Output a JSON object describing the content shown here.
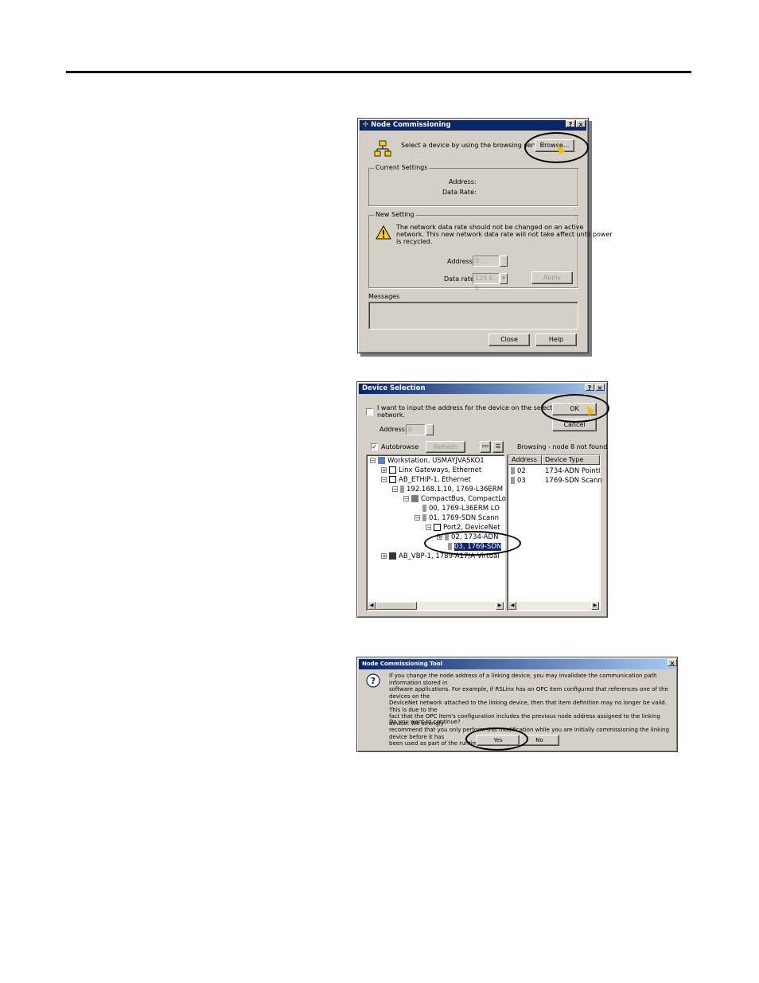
{
  "node_commissioning": {
    "title": "Node Commissioning",
    "help_btn": "?",
    "close_btn": "×",
    "prompt": "Select a device by using the browsing service",
    "browse_label": "Browse...",
    "current_settings": {
      "title": "Current Settings",
      "address_label": "Address:",
      "data_rate_label": "Data Rate:"
    },
    "new_setting": {
      "title": "New Setting",
      "warning_line1": "The network data rate should not be changed on an active",
      "warning_line2": "network. This new network data rate will not take affect until power",
      "warning_line3": "is recycled.",
      "address_label": "Address",
      "address_value": "0",
      "data_rate_label": "Data rate",
      "data_rate_value": "125 k b",
      "apply_label": "Apply"
    },
    "messages_label": "Messages",
    "close_label": "Close",
    "help_label": "Help"
  },
  "device_selection": {
    "title": "Device Selection",
    "help_btn": "?",
    "close_btn": "×",
    "manual_line1": "I want to input the address for the device on the selected",
    "manual_line2": "network.",
    "address_label": "Address:",
    "address_value": "0",
    "ok_label": "OK",
    "cancel_label": "Cancel",
    "autobrowse_label": "Autobrowse",
    "refresh_label": "Refresh",
    "status": "Browsing - node 8 not found",
    "tree": [
      {
        "text": "Workstation, USMAYJVASKO1"
      },
      {
        "text": "Linx Gateways, Ethernet"
      },
      {
        "text": "AB_ETHIP-1, Ethernet"
      },
      {
        "text": "192.168.1.10, 1769-L36ERM"
      },
      {
        "text": "CompactBus, CompactLo"
      },
      {
        "text": "00, 1769-L36ERM LO"
      },
      {
        "text": "01, 1769-SDN Scann"
      },
      {
        "text": "Port2, DeviceNet"
      },
      {
        "text": "02, 1734-ADN"
      },
      {
        "text": "03, 1769-SDN"
      },
      {
        "text": "AB_VBP-1, 1789-A17/A Virtual"
      }
    ],
    "columns": [
      "Address",
      "Device Type"
    ],
    "rows": [
      {
        "address": "02",
        "type": "1734-ADN PointI"
      },
      {
        "address": "03",
        "type": "1769-SDN Scann"
      }
    ]
  },
  "nct": {
    "title": "Node Commissioning Tool",
    "close_btn": "×",
    "body_lines": [
      "If you change the node address of a linking device, you may invalidate the communication path information stored in",
      "software applications. For example, if RSLinx has an OPC item configured that references one of the devices on the",
      "DeviceNet network attached to the linking device, then that item definition may no longer be valid. This is due to the",
      "fact that the OPC item's configuration includes the previous node address assigned to the linking device. We strongly",
      "recommend that you only perform this modification while you are initially commissioning the linking device before it has",
      "been used as part of the runtime control system."
    ],
    "question": "Do you want to continue?",
    "yes_label": "Yes",
    "no_label": "No"
  }
}
